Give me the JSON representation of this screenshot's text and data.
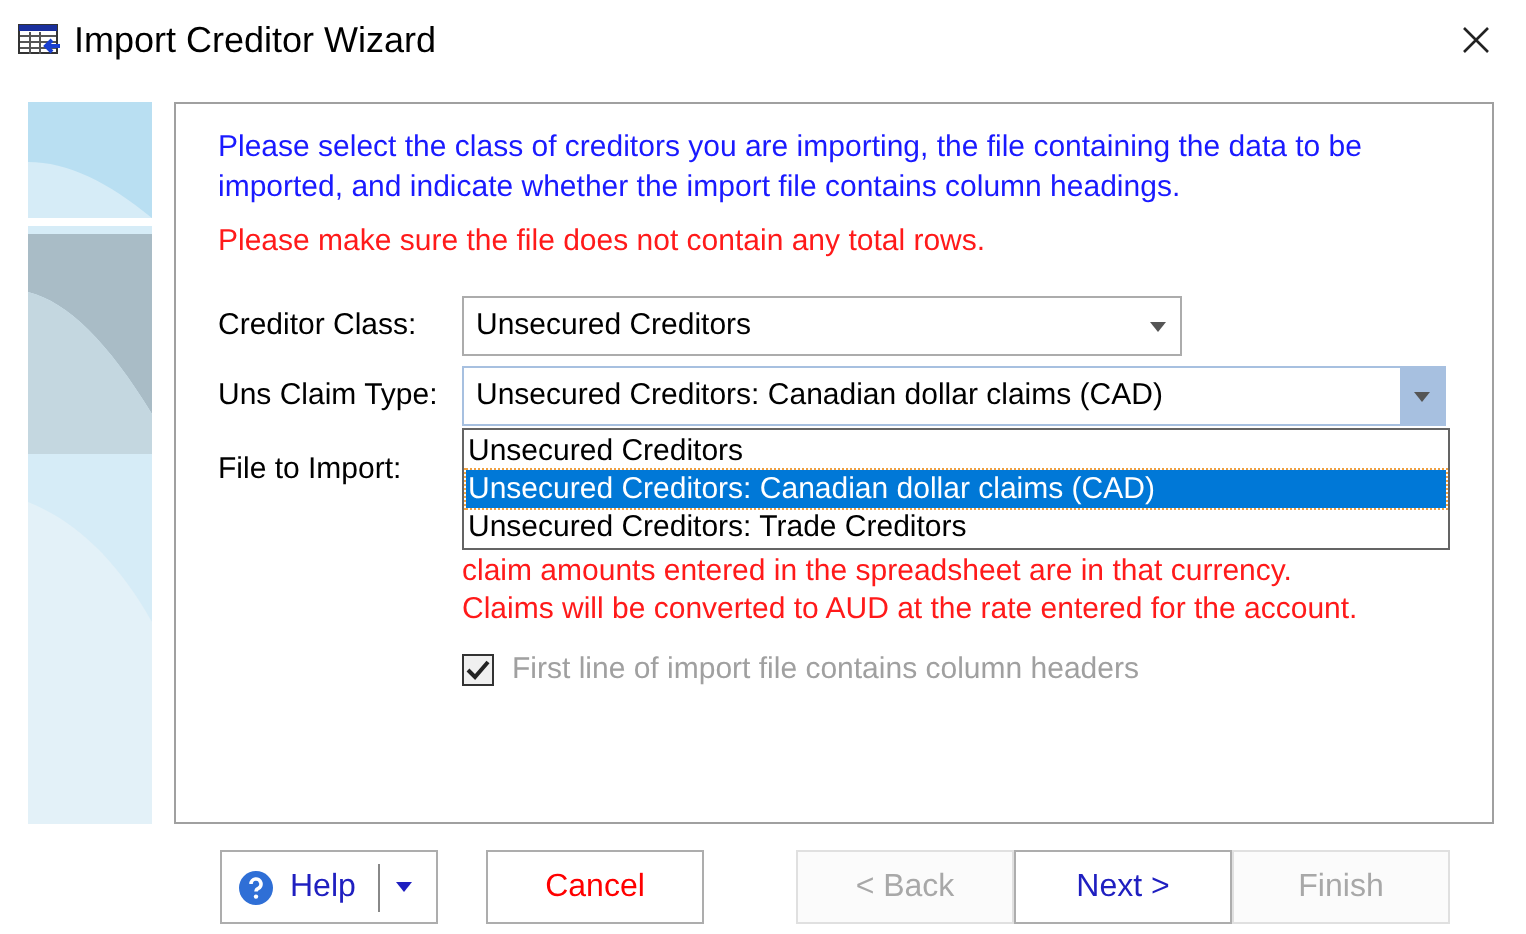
{
  "window": {
    "title": "Import Creditor Wizard"
  },
  "sidebar": {
    "kind": "picture"
  },
  "instructions": "Please select the class of creditors you are importing, the file containing the data to be imported, and indicate whether the import file contains column headings.",
  "warning": "Please make sure the file does not contain any total rows.",
  "fields": [
    {
      "label": "Creditor Class:",
      "value": "Unsecured Creditors",
      "focused": false
    },
    {
      "label": "Uns Claim Type:",
      "value": "Unsecured Creditors: Canadian dollar claims (CAD)",
      "focused": true
    }
  ],
  "file_label": "File to Import:",
  "dropdown_options": [
    {
      "label": "Unsecured Creditors",
      "selected": false
    },
    {
      "label": "Unsecured Creditors: Canadian dollar claims (CAD)",
      "selected": true
    },
    {
      "label": "Unsecured Creditors: Trade Creditors",
      "selected": false
    }
  ],
  "currency_notes": [
    "claim amounts entered in the spreadsheet are in that currency.",
    "Claims will be converted to AUD at the rate entered for the account."
  ],
  "header_checkbox": {
    "label": "First line of import file contains column headers",
    "checked": true,
    "disabled": true
  },
  "buttons": [
    {
      "label": "Help",
      "kind": "split",
      "disabled": false
    },
    {
      "label": "Cancel",
      "kind": "cancel",
      "disabled": false
    },
    {
      "label": "< Back",
      "kind": "nav",
      "disabled": true
    },
    {
      "label": "Next >",
      "kind": "nav",
      "disabled": false
    },
    {
      "label": "Finish",
      "kind": "finish",
      "disabled": true
    }
  ]
}
